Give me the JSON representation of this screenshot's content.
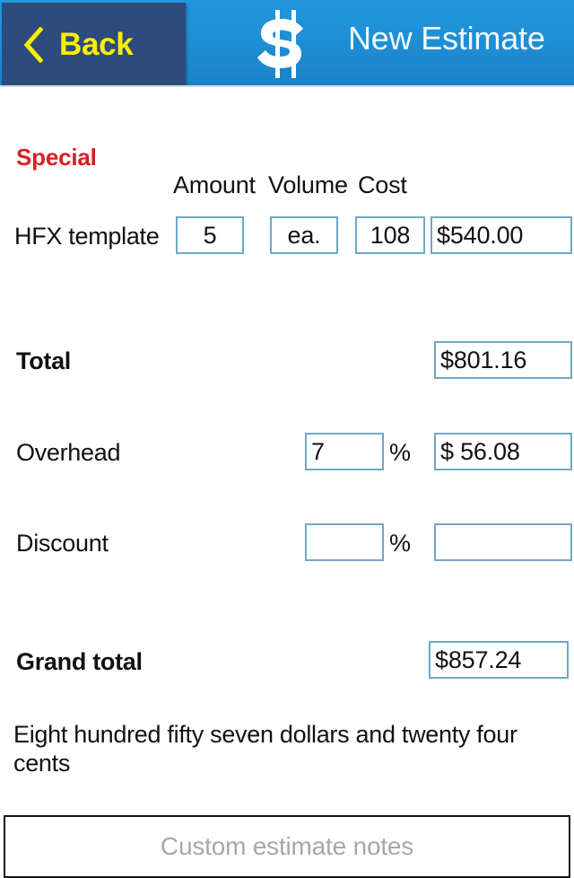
{
  "header": {
    "back_label": "Back",
    "title": "New Estimate",
    "back_icon": "chevron-left-icon",
    "logo_icon": "dollar-sign-logo",
    "accent_blue": "#1f8fd6",
    "back_button_color": "#2d4b7c",
    "back_text_color": "#ffee00"
  },
  "section": {
    "label": "Special",
    "label_color": "#d81f26"
  },
  "table": {
    "columns": [
      "Amount",
      "Volume",
      "Cost"
    ],
    "rows": [
      {
        "label": "HFX template",
        "amount": "5",
        "volume": "ea.",
        "cost": "108",
        "total": "$540.00"
      }
    ]
  },
  "totals": {
    "total_label": "Total",
    "total_value": "$801.16",
    "overhead_label": "Overhead",
    "overhead_percent": "7",
    "overhead_value": "$ 56.08",
    "discount_label": "Discount",
    "discount_percent": "",
    "discount_value": "",
    "percent_sign": "%",
    "grand_total_label": "Grand total",
    "grand_total_value": "$857.24"
  },
  "amount_in_words": "Eight hundred fifty seven dollars and twenty four cents",
  "notes": {
    "placeholder": "Custom estimate notes",
    "value": ""
  }
}
